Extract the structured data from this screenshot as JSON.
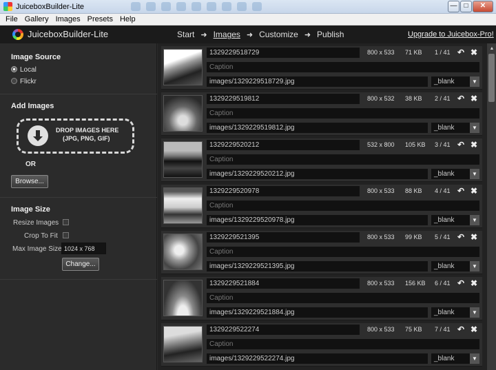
{
  "window": {
    "title": "JuiceboxBuilder-Lite"
  },
  "menu": [
    "File",
    "Gallery",
    "Images",
    "Presets",
    "Help"
  ],
  "header": {
    "app_name": "JuiceboxBuilder-Lite",
    "steps": [
      "Start",
      "Images",
      "Customize",
      "Publish"
    ],
    "active_step": "Images",
    "upgrade_link": "Upgrade to Juicebox-Pro!"
  },
  "left": {
    "image_source": {
      "title": "Image Source",
      "options": [
        "Local",
        "Flickr"
      ],
      "selected": "Local"
    },
    "add_images": {
      "title": "Add Images",
      "drop_line1": "DROP IMAGES HERE",
      "drop_line2": "(JPG, PNG, GIF)",
      "or_text": "OR",
      "browse_label": "Browse..."
    },
    "image_size": {
      "title": "Image Size",
      "resize_label": "Resize Images",
      "resize_checked": false,
      "crop_label": "Crop To Fit",
      "crop_checked": false,
      "max_label": "Max Image Size",
      "max_value": "1024 x 768",
      "change_label": "Change..."
    }
  },
  "images": [
    {
      "title": "1329229518729",
      "caption_placeholder": "Caption",
      "path": "images/1329229518729.jpg",
      "dims": "800 x 533",
      "size": "71 KB",
      "index": "1 / 41",
      "target": "_blank"
    },
    {
      "title": "1329229519812",
      "caption_placeholder": "Caption",
      "path": "images/1329229519812.jpg",
      "dims": "800 x 532",
      "size": "38 KB",
      "index": "2 / 41",
      "target": "_blank"
    },
    {
      "title": "1329229520212",
      "caption_placeholder": "Caption",
      "path": "images/1329229520212.jpg",
      "dims": "532 x 800",
      "size": "105 KB",
      "index": "3 / 41",
      "target": "_blank"
    },
    {
      "title": "1329229520978",
      "caption_placeholder": "Caption",
      "path": "images/1329229520978.jpg",
      "dims": "800 x 533",
      "size": "88 KB",
      "index": "4 / 41",
      "target": "_blank"
    },
    {
      "title": "1329229521395",
      "caption_placeholder": "Caption",
      "path": "images/1329229521395.jpg",
      "dims": "800 x 533",
      "size": "99 KB",
      "index": "5 / 41",
      "target": "_blank"
    },
    {
      "title": "1329229521884",
      "caption_placeholder": "Caption",
      "path": "images/1329229521884.jpg",
      "dims": "800 x 533",
      "size": "156 KB",
      "index": "6 / 41",
      "target": "_blank"
    },
    {
      "title": "1329229522274",
      "caption_placeholder": "Caption",
      "path": "images/1329229522274.jpg",
      "dims": "800 x 533",
      "size": "75 KB",
      "index": "7 / 41",
      "target": "_blank"
    }
  ],
  "icons": {
    "undo": "undo-arrow-icon",
    "remove": "close-x-icon",
    "download": "download-arrow-icon",
    "dropdown": "chevron-down-icon"
  }
}
